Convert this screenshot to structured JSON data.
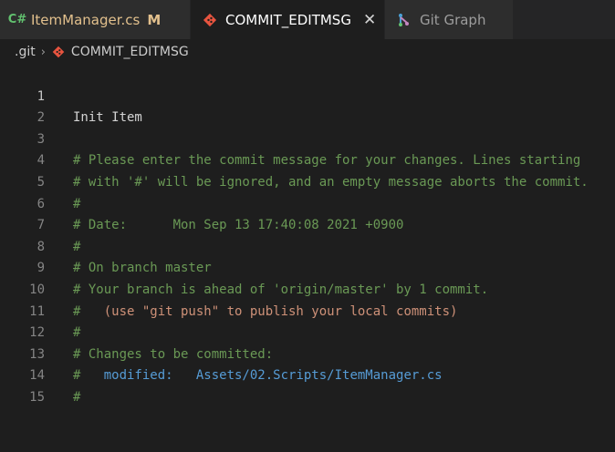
{
  "tabs": [
    {
      "icon": "C#",
      "label": "ItemManager.cs",
      "badge": "M"
    },
    {
      "label": "COMMIT_EDITMSG",
      "close": "✕"
    },
    {
      "label": "Git Graph"
    }
  ],
  "breadcrumb": {
    "folder": ".git",
    "separator": "›",
    "file": "COMMIT_EDITMSG"
  },
  "lines": [
    {
      "num": "1",
      "text": "Init Item"
    },
    {
      "num": "2",
      "text": ""
    },
    {
      "num": "3",
      "text": "# Please enter the commit message for your changes. Lines starting"
    },
    {
      "num": "4",
      "text": "# with '#' will be ignored, and an empty message aborts the commit."
    },
    {
      "num": "5",
      "text": "#"
    },
    {
      "num": "6",
      "text": "# Date:      Mon Sep 13 17:40:08 2021 +0900"
    },
    {
      "num": "7",
      "text": "#"
    },
    {
      "num": "8",
      "text": "# On branch master"
    },
    {
      "num": "9",
      "text": "# Your branch is ahead of 'origin/master' by 1 commit."
    },
    {
      "num": "10",
      "prefix": "#   ",
      "hint": "(use \"git push\" to publish your local commits)"
    },
    {
      "num": "11",
      "text": "#"
    },
    {
      "num": "12",
      "text": "# Changes to be committed:"
    },
    {
      "num": "13",
      "prefix": "#   ",
      "keyword": "modified:",
      "path": "   Assets/02.Scripts/ItemManager.cs"
    },
    {
      "num": "14",
      "text": "#"
    },
    {
      "num": "15",
      "text": ""
    }
  ]
}
